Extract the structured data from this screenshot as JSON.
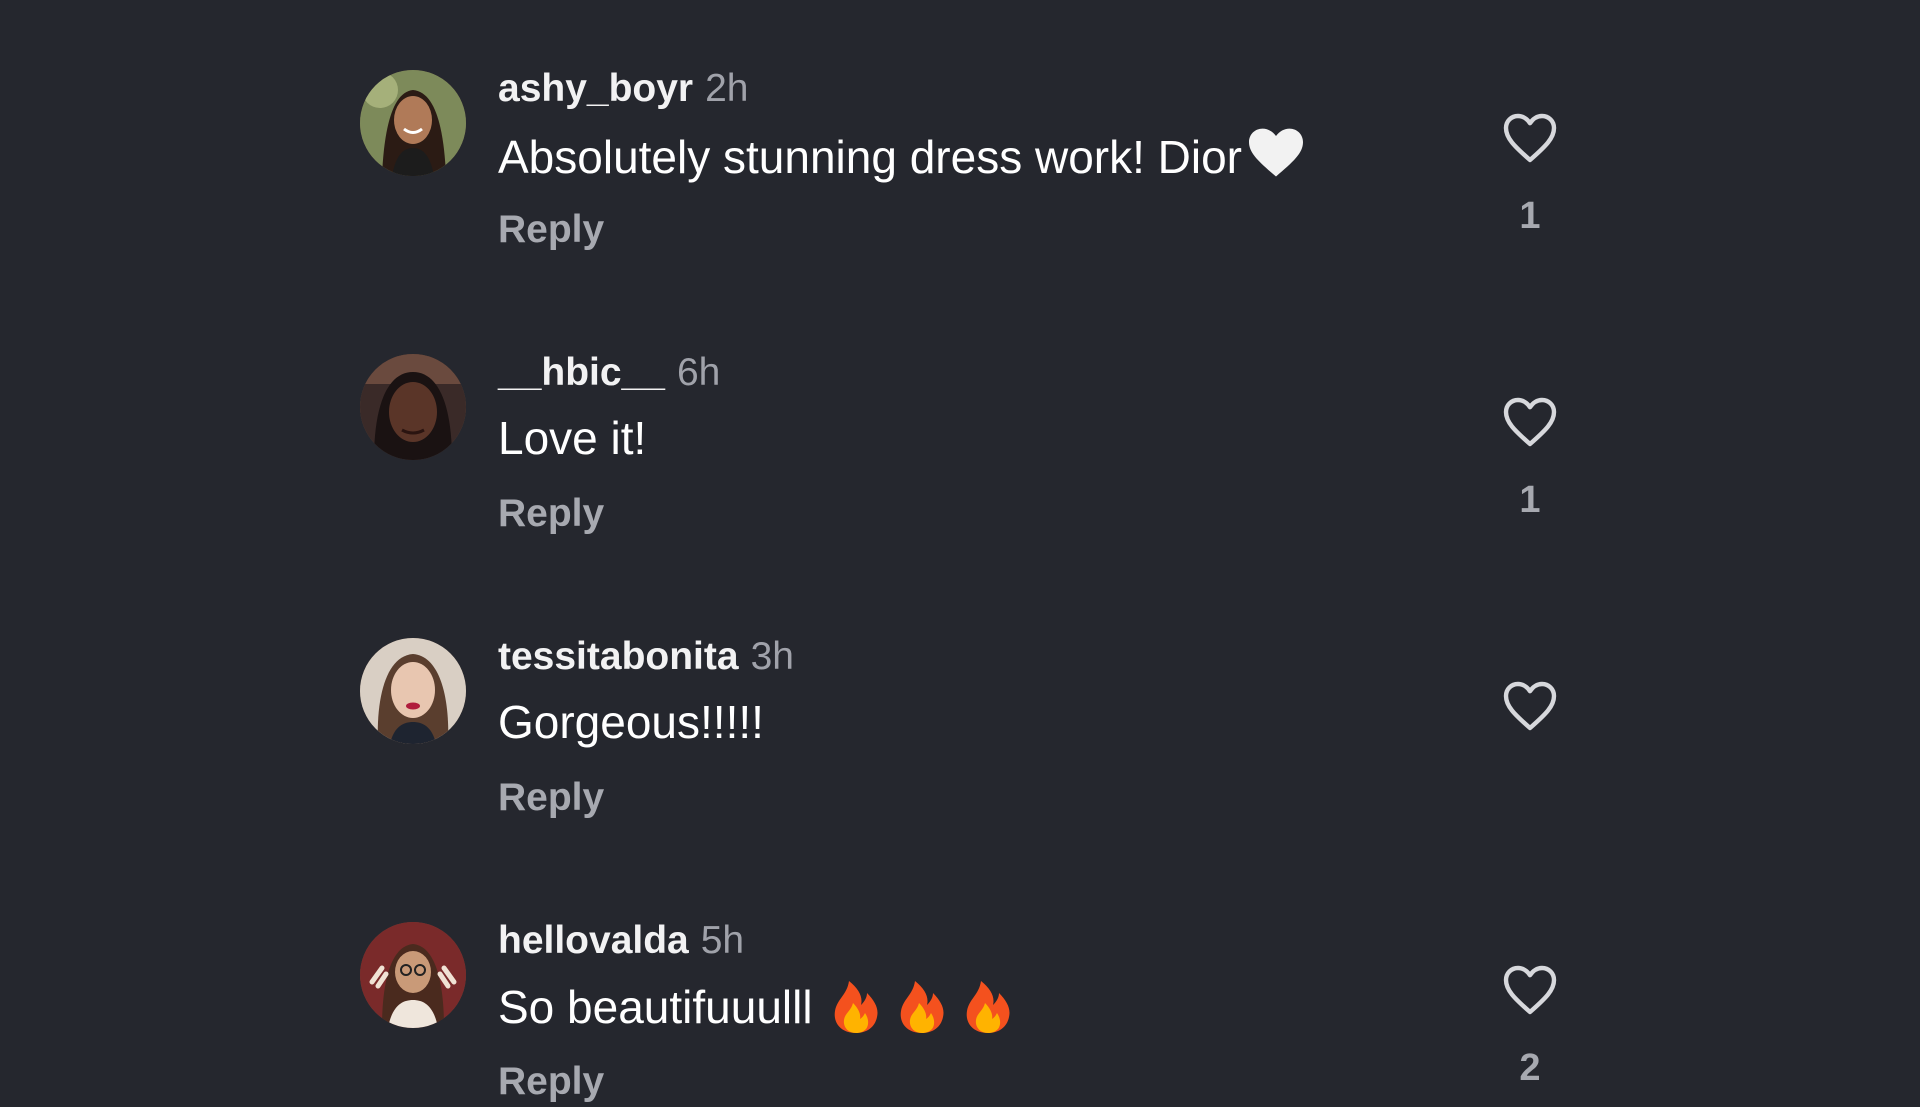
{
  "comments": [
    {
      "username": "ashy_boyr",
      "time": "2h",
      "text": "Absolutely stunning dress work! Dior",
      "emoji": "white-heart-icon",
      "reply_label": "Reply",
      "likes": "1",
      "avatar_color": "#5b7a46"
    },
    {
      "username": "__hbic__",
      "time": "6h",
      "text": "Love it!",
      "reply_label": "Reply",
      "likes": "1",
      "avatar_color": "#3d2b2a"
    },
    {
      "username": "tessitabonita",
      "time": "3h",
      "text": "Gorgeous!!!!!",
      "reply_label": "Reply",
      "likes": "",
      "avatar_color": "#c8b8a8"
    },
    {
      "username": "hellovalda",
      "time": "5h",
      "text": "So beautifuuulll",
      "emoji": "fire-icon",
      "reply_label": "Reply",
      "likes": "2",
      "avatar_color": "#6e2424"
    }
  ],
  "colors": {
    "background": "#25272e",
    "secondary_text": "#a7a9b0",
    "heart_outline": "#d7d8dc"
  }
}
